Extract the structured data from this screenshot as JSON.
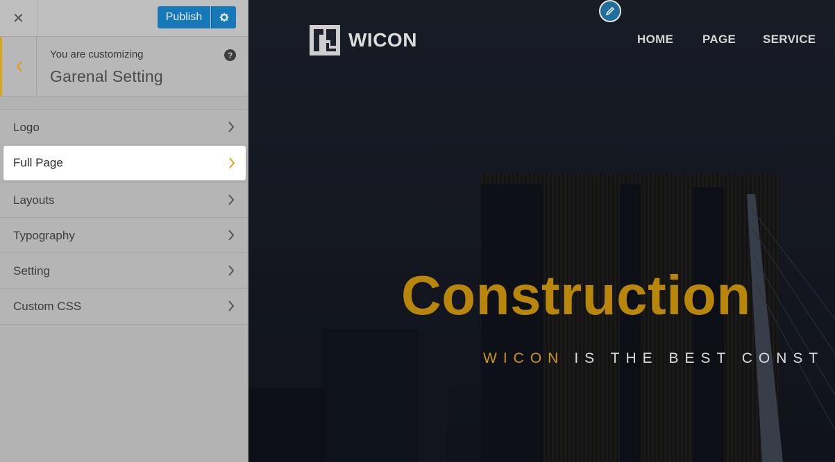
{
  "topbar": {
    "close_icon": "close-icon",
    "publish_label": "Publish",
    "settings_icon": "gear-icon",
    "accent_color": "#1678b7"
  },
  "section": {
    "customizing_label": "You are customizing",
    "title": "Garenal Setting",
    "help_icon": "question-icon",
    "back_icon": "chevron-left-icon"
  },
  "menu": {
    "items": [
      {
        "label": "Logo"
      },
      {
        "label": "Full Page"
      },
      {
        "label": "Layouts"
      },
      {
        "label": "Typography"
      },
      {
        "label": "Setting"
      },
      {
        "label": "Custom CSS"
      }
    ],
    "active_index": 1
  },
  "preview": {
    "brand": "WICON",
    "nav": [
      "HOME",
      "PAGE",
      "SERVICE"
    ],
    "hero_title": "Construction",
    "hero_sub_brand": "WICON",
    "hero_sub_rest": "IS THE BEST CONST",
    "accent_color": "#b8860b",
    "edit_icon": "pencil-icon"
  }
}
